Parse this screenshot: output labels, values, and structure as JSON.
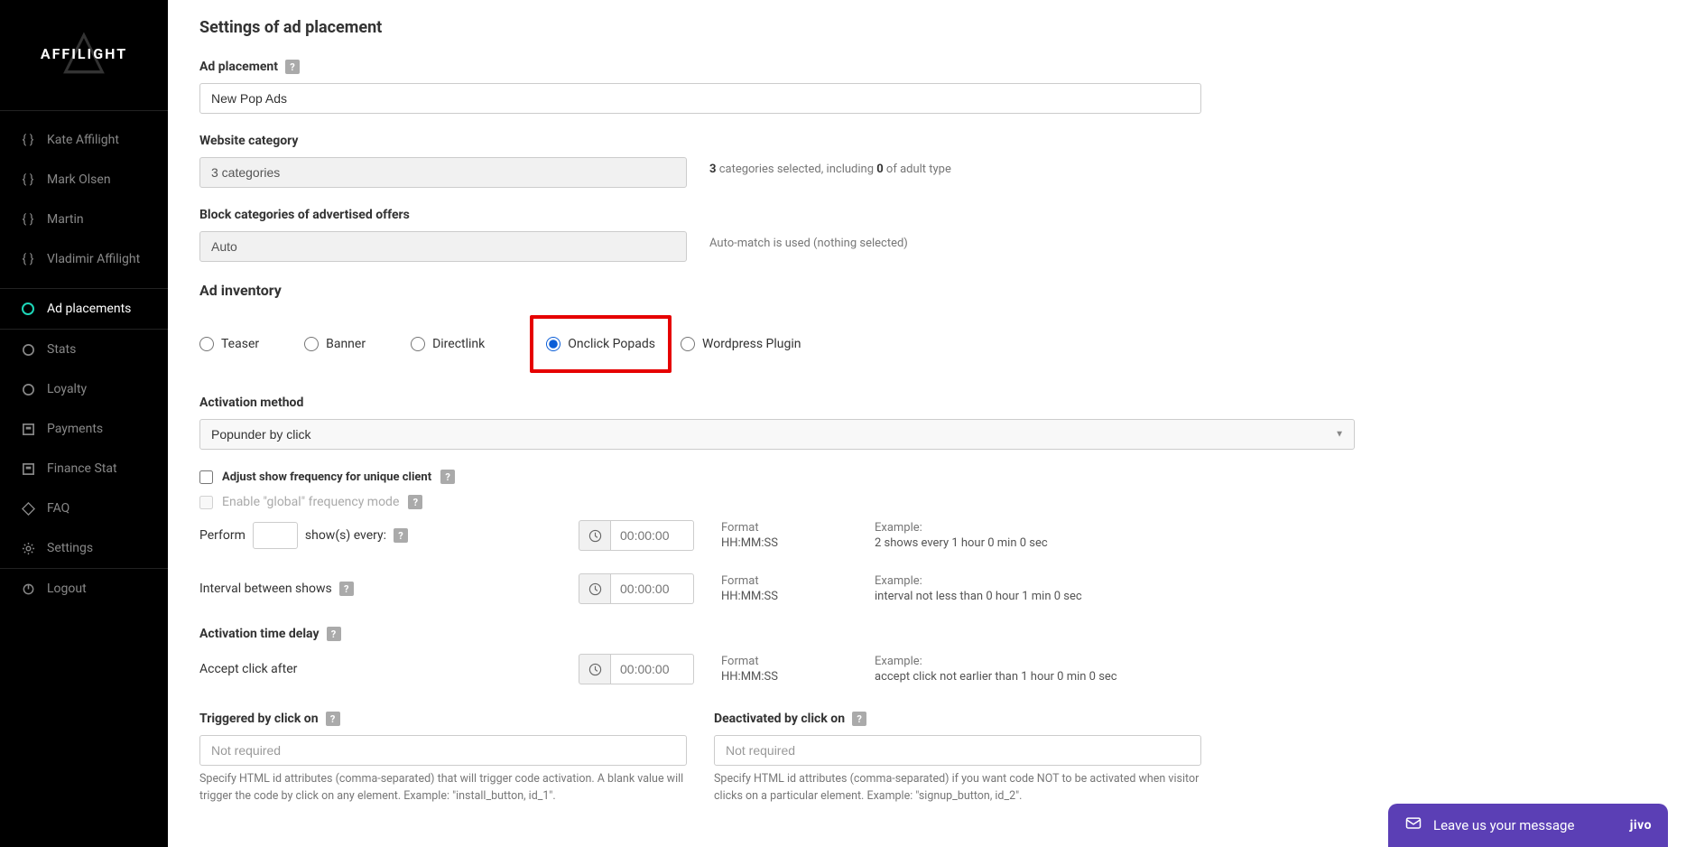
{
  "logo_text": "AFFILIGHT",
  "sidebar": {
    "users": [
      {
        "label": "Kate Affilight"
      },
      {
        "label": "Mark Olsen"
      },
      {
        "label": "Martin"
      },
      {
        "label": "Vladimir Affilight"
      }
    ],
    "nav": [
      {
        "label": "Ad placements",
        "active": true
      },
      {
        "label": "Stats"
      },
      {
        "label": "Loyalty"
      },
      {
        "label": "Payments"
      },
      {
        "label": "Finance Stat"
      },
      {
        "label": "FAQ"
      },
      {
        "label": "Settings"
      }
    ],
    "logout": "Logout"
  },
  "page": {
    "title": "Settings of ad placement",
    "ad_placement": {
      "label": "Ad placement",
      "value": "New Pop Ads"
    },
    "website_category": {
      "label": "Website category",
      "value": "3 categories",
      "hint_prefix": "3",
      "hint_mid": " categories selected, including ",
      "hint_count": "0",
      "hint_suffix": " of adult type"
    },
    "block_categories": {
      "label": "Block categories of advertised offers",
      "value": "Auto",
      "hint": "Auto-match is used (nothing selected)"
    },
    "ad_inventory": {
      "title": "Ad inventory",
      "options": [
        {
          "label": "Teaser",
          "selected": false
        },
        {
          "label": "Banner",
          "selected": false
        },
        {
          "label": "Directlink",
          "selected": false
        },
        {
          "label": "Onclick Popads",
          "selected": true
        },
        {
          "label": "Wordpress Plugin",
          "selected": false
        }
      ]
    },
    "activation_method": {
      "label": "Activation method",
      "value": "Popunder by click"
    },
    "adjust_frequency": {
      "label": "Adjust show frequency for unique client",
      "checked": false
    },
    "global_frequency": {
      "label": "Enable \"global\" frequency mode",
      "checked": false
    },
    "perform": {
      "prefix": "Perform",
      "suffix": "show(s) every:",
      "time_placeholder": "00:00:00",
      "format_label": "Format",
      "format_value": "HH:MM:SS",
      "example_label": "Example:",
      "example_value": "2 shows every 1 hour 0 min 0 sec"
    },
    "interval": {
      "label": "Interval between shows",
      "time_placeholder": "00:00:00",
      "format_label": "Format",
      "format_value": "HH:MM:SS",
      "example_label": "Example:",
      "example_value": "interval not less than 0 hour 1 min 0 sec"
    },
    "activation_delay": {
      "label": "Activation time delay",
      "accept_label": "Accept click after",
      "time_placeholder": "00:00:00",
      "format_label": "Format",
      "format_value": "HH:MM:SS",
      "example_label": "Example:",
      "example_value": "accept click not earlier than 1 hour 0 min 0 sec"
    },
    "triggered": {
      "label": "Triggered by click on",
      "placeholder": "Not required",
      "help": "Specify HTML id attributes (comma-separated) that will trigger code activation. A blank value will trigger the code by click on any element. Example: \"install_button, id_1\"."
    },
    "deactivated": {
      "label": "Deactivated by click on",
      "placeholder": "Not required",
      "help": "Specify HTML id attributes (comma-separated) if you want code NOT to be activated when visitor clicks on a particular element. Example: \"signup_button, id_2\"."
    }
  },
  "chat": {
    "text": "Leave us your message",
    "brand": "jivo"
  }
}
